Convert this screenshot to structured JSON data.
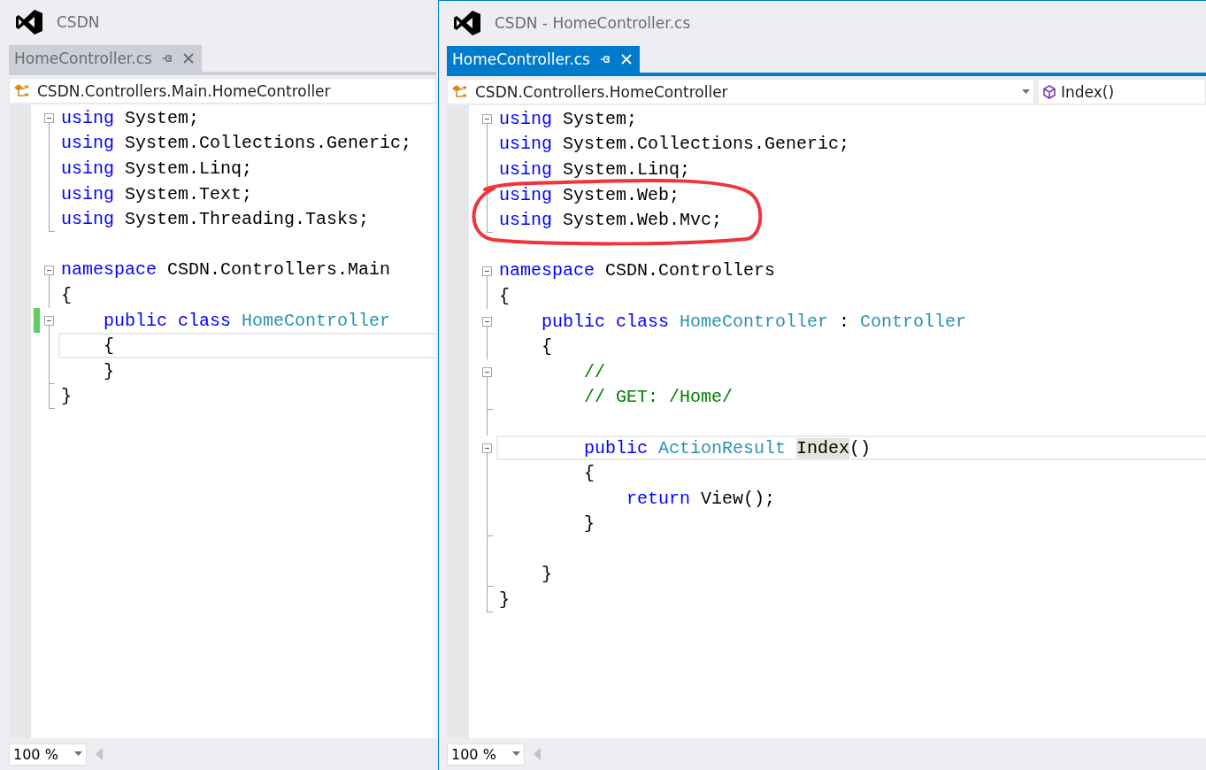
{
  "windows": [
    {
      "title": "CSDN",
      "active": false,
      "tab": {
        "label": "HomeController.cs"
      },
      "nav": [
        {
          "kind": "type",
          "text": "CSDN.Controllers.Main.HomeController",
          "caret": false
        }
      ],
      "zoom": "100 %",
      "lines": [
        {
          "fold": true,
          "guide": false,
          "end": false,
          "current": false,
          "changed": false,
          "tokens": [
            {
              "kind": "kw",
              "text": "using"
            },
            {
              "kind": "plain",
              "text": " System;"
            }
          ]
        },
        {
          "fold": false,
          "guide": true,
          "end": false,
          "current": false,
          "changed": false,
          "tokens": [
            {
              "kind": "kw",
              "text": "using"
            },
            {
              "kind": "plain",
              "text": " System.Collections.Generic;"
            }
          ]
        },
        {
          "fold": false,
          "guide": true,
          "end": false,
          "current": false,
          "changed": false,
          "tokens": [
            {
              "kind": "kw",
              "text": "using"
            },
            {
              "kind": "plain",
              "text": " System.Linq;"
            }
          ]
        },
        {
          "fold": false,
          "guide": true,
          "end": false,
          "current": false,
          "changed": false,
          "tokens": [
            {
              "kind": "kw",
              "text": "using"
            },
            {
              "kind": "plain",
              "text": " System.Text;"
            }
          ]
        },
        {
          "fold": false,
          "guide": false,
          "end": true,
          "current": false,
          "changed": false,
          "tokens": [
            {
              "kind": "kw",
              "text": "using"
            },
            {
              "kind": "plain",
              "text": " System.Threading.Tasks;"
            }
          ]
        },
        {
          "fold": false,
          "guide": false,
          "end": false,
          "current": false,
          "changed": false
        },
        {
          "fold": true,
          "guide": false,
          "end": false,
          "current": false,
          "changed": false,
          "tokens": [
            {
              "kind": "kw",
              "text": "namespace"
            },
            {
              "kind": "plain",
              "text": " CSDN.Controllers.Main"
            }
          ]
        },
        {
          "fold": false,
          "guide": true,
          "end": false,
          "current": false,
          "changed": false,
          "tokens": [
            {
              "kind": "plain",
              "text": "{"
            }
          ]
        },
        {
          "fold": true,
          "guide": false,
          "end": false,
          "current": false,
          "changed": true,
          "tokens": [
            {
              "kind": "kw",
              "text": "    public class "
            },
            {
              "kind": "type",
              "text": "HomeController"
            }
          ]
        },
        {
          "fold": false,
          "guide": true,
          "end": false,
          "current": true,
          "changed": false,
          "tokens": [
            {
              "kind": "plain",
              "text": "    {"
            }
          ]
        },
        {
          "fold": false,
          "guide": false,
          "end": true,
          "current": false,
          "changed": false,
          "tokens": [
            {
              "kind": "plain",
              "text": "    }"
            }
          ]
        },
        {
          "fold": false,
          "guide": false,
          "end": true,
          "current": false,
          "changed": false,
          "tokens": [
            {
              "kind": "plain",
              "text": "}"
            }
          ]
        }
      ]
    },
    {
      "title": "CSDN - HomeController.cs",
      "active": true,
      "tab": {
        "label": "HomeController.cs"
      },
      "nav": [
        {
          "kind": "type",
          "text": "CSDN.Controllers.HomeController",
          "caret": true
        },
        {
          "kind": "member",
          "text": "Index()",
          "caret": false
        }
      ],
      "zoom": "100 %",
      "lines": [
        {
          "fold": true,
          "guide": false,
          "end": false,
          "current": false,
          "changed": false,
          "tokens": [
            {
              "kind": "kw",
              "text": "using"
            },
            {
              "kind": "plain",
              "text": " System;"
            }
          ]
        },
        {
          "fold": false,
          "guide": true,
          "end": false,
          "current": false,
          "changed": false,
          "tokens": [
            {
              "kind": "kw",
              "text": "using"
            },
            {
              "kind": "plain",
              "text": " System.Collections.Generic;"
            }
          ]
        },
        {
          "fold": false,
          "guide": true,
          "end": false,
          "current": false,
          "changed": false,
          "tokens": [
            {
              "kind": "kw",
              "text": "using"
            },
            {
              "kind": "plain",
              "text": " System.Linq;"
            }
          ]
        },
        {
          "fold": false,
          "guide": true,
          "end": false,
          "current": false,
          "changed": false,
          "tokens": [
            {
              "kind": "kw",
              "text": "using"
            },
            {
              "kind": "plain",
              "text": " System.Web;"
            }
          ]
        },
        {
          "fold": false,
          "guide": false,
          "end": true,
          "current": false,
          "changed": false,
          "tokens": [
            {
              "kind": "kw",
              "text": "using"
            },
            {
              "kind": "plain",
              "text": " System.Web.Mvc;"
            }
          ]
        },
        {
          "fold": false,
          "guide": false,
          "end": false,
          "current": false,
          "changed": false
        },
        {
          "fold": true,
          "guide": false,
          "end": false,
          "current": false,
          "changed": false,
          "tokens": [
            {
              "kind": "kw",
              "text": "namespace"
            },
            {
              "kind": "plain",
              "text": " CSDN.Controllers"
            }
          ]
        },
        {
          "fold": false,
          "guide": true,
          "end": false,
          "current": false,
          "changed": false,
          "tokens": [
            {
              "kind": "plain",
              "text": "{"
            }
          ]
        },
        {
          "fold": true,
          "guide": false,
          "end": false,
          "current": false,
          "changed": false,
          "tokens": [
            {
              "kind": "kw",
              "text": "    public class "
            },
            {
              "kind": "type",
              "text": "HomeController"
            },
            {
              "kind": "plain",
              "text": " : "
            },
            {
              "kind": "type",
              "text": "Controller"
            }
          ]
        },
        {
          "fold": false,
          "guide": true,
          "end": false,
          "current": false,
          "changed": false,
          "tokens": [
            {
              "kind": "plain",
              "text": "    {"
            }
          ]
        },
        {
          "fold": true,
          "guide": false,
          "end": false,
          "current": false,
          "changed": false,
          "tokens": [
            {
              "kind": "comment",
              "text": "        //"
            }
          ]
        },
        {
          "fold": false,
          "guide": false,
          "end": true,
          "current": false,
          "changed": false,
          "tokens": [
            {
              "kind": "comment",
              "text": "        // GET: /Home/"
            }
          ]
        },
        {
          "fold": false,
          "guide": true,
          "end": false,
          "current": false,
          "changed": false
        },
        {
          "fold": true,
          "guide": false,
          "end": false,
          "current": true,
          "changed": false,
          "tokens": [
            {
              "kind": "kw",
              "text": "        public "
            },
            {
              "kind": "type",
              "text": "ActionResult "
            },
            {
              "kind": "mark",
              "text": "Index"
            },
            {
              "kind": "plain",
              "text": "()"
            }
          ]
        },
        {
          "fold": false,
          "guide": true,
          "end": false,
          "current": false,
          "changed": false,
          "tokens": [
            {
              "kind": "plain",
              "text": "        {"
            }
          ]
        },
        {
          "fold": false,
          "guide": true,
          "end": false,
          "current": false,
          "changed": false,
          "tokens": [
            {
              "kind": "kw",
              "text": "            return"
            },
            {
              "kind": "plain",
              "text": " View();"
            }
          ]
        },
        {
          "fold": false,
          "guide": false,
          "end": true,
          "current": false,
          "changed": false,
          "tokens": [
            {
              "kind": "plain",
              "text": "        }"
            }
          ]
        },
        {
          "fold": false,
          "guide": true,
          "end": false,
          "current": false,
          "changed": false
        },
        {
          "fold": false,
          "guide": false,
          "end": true,
          "current": false,
          "changed": false,
          "tokens": [
            {
              "kind": "plain",
              "text": "    }"
            }
          ]
        },
        {
          "fold": false,
          "guide": false,
          "end": true,
          "current": false,
          "changed": false,
          "tokens": [
            {
              "kind": "plain",
              "text": "}"
            }
          ]
        }
      ]
    }
  ]
}
